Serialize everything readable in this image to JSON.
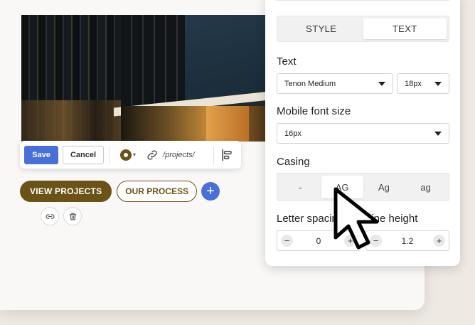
{
  "toolbar": {
    "save_label": "Save",
    "cancel_label": "Cancel",
    "button_color": "#6b5216",
    "link_path": "/projects/"
  },
  "buttons": {
    "primary_label": "VIEW PROJECTS",
    "secondary_label": "OUR PROCESS",
    "add_label": "+"
  },
  "panel": {
    "tabs": [
      {
        "label": "STYLE",
        "active": false
      },
      {
        "label": "TEXT",
        "active": true
      }
    ],
    "text": {
      "label": "Text",
      "font_family": "Tenon Medium",
      "font_size": "18px"
    },
    "mobile": {
      "label": "Mobile font size",
      "value": "16px"
    },
    "casing": {
      "label": "Casing",
      "options": [
        "-",
        "AG",
        "Ag",
        "ag"
      ],
      "selected": "AG"
    },
    "letter_spacing": {
      "label": "Letter spacing",
      "value": "0"
    },
    "line_height": {
      "label": "Line height",
      "value": "1.2"
    }
  },
  "colors": {
    "accent_blue": "#4a6fd8",
    "brand_brown": "#6b5216"
  }
}
